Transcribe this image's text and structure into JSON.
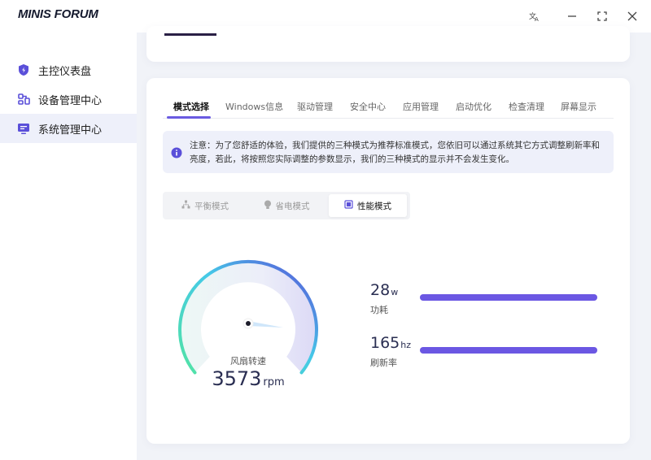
{
  "app": {
    "logo_text": "MINIS FORUM",
    "window_buttons": [
      "translate-icon",
      "minimize-icon",
      "maximize-icon",
      "close-icon"
    ]
  },
  "sidebar": {
    "items": [
      {
        "label": "主控仪表盘",
        "icon": "shield-icon",
        "active": false
      },
      {
        "label": "设备管理中心",
        "icon": "device-icon",
        "active": false
      },
      {
        "label": "系统管理中心",
        "icon": "monitor-icon",
        "active": true
      }
    ]
  },
  "tabs": [
    {
      "label": "模式选择",
      "active": true
    },
    {
      "label": "Windows信息",
      "active": false
    },
    {
      "label": "驱动管理",
      "active": false
    },
    {
      "label": "安全中心",
      "active": false
    },
    {
      "label": "应用管理",
      "active": false
    },
    {
      "label": "启动优化",
      "active": false
    },
    {
      "label": "检查清理",
      "active": false
    },
    {
      "label": "屏幕显示",
      "active": false
    }
  ],
  "notice": {
    "icon": "info-icon",
    "text": "注意：为了您舒适的体验，我们提供的三种模式为推荐标准模式，您依旧可以通过系统其它方式调整刷新率和亮度，若此，将按照您实际调整的参数显示，我们的三种模式的显示并不会发生变化。"
  },
  "modes": [
    {
      "label": "平衡模式",
      "icon": "hierarchy-icon",
      "active": false
    },
    {
      "label": "省电模式",
      "icon": "bulb-icon",
      "active": false
    },
    {
      "label": "性能模式",
      "icon": "chip-icon",
      "active": true
    }
  ],
  "gauge": {
    "label": "风扇转速",
    "value": "3573",
    "unit": "rpm"
  },
  "metrics": [
    {
      "value": "28",
      "unit": "w",
      "label": "功耗",
      "fill": 1.0
    },
    {
      "value": "165",
      "unit": "hz",
      "label": "刷新率",
      "fill": 1.0
    }
  ],
  "colors": {
    "accent": "#6a5be1",
    "gauge_start": "#52e3a4",
    "gauge_mid": "#45c9e8",
    "gauge_end": "#5b4bd8"
  }
}
